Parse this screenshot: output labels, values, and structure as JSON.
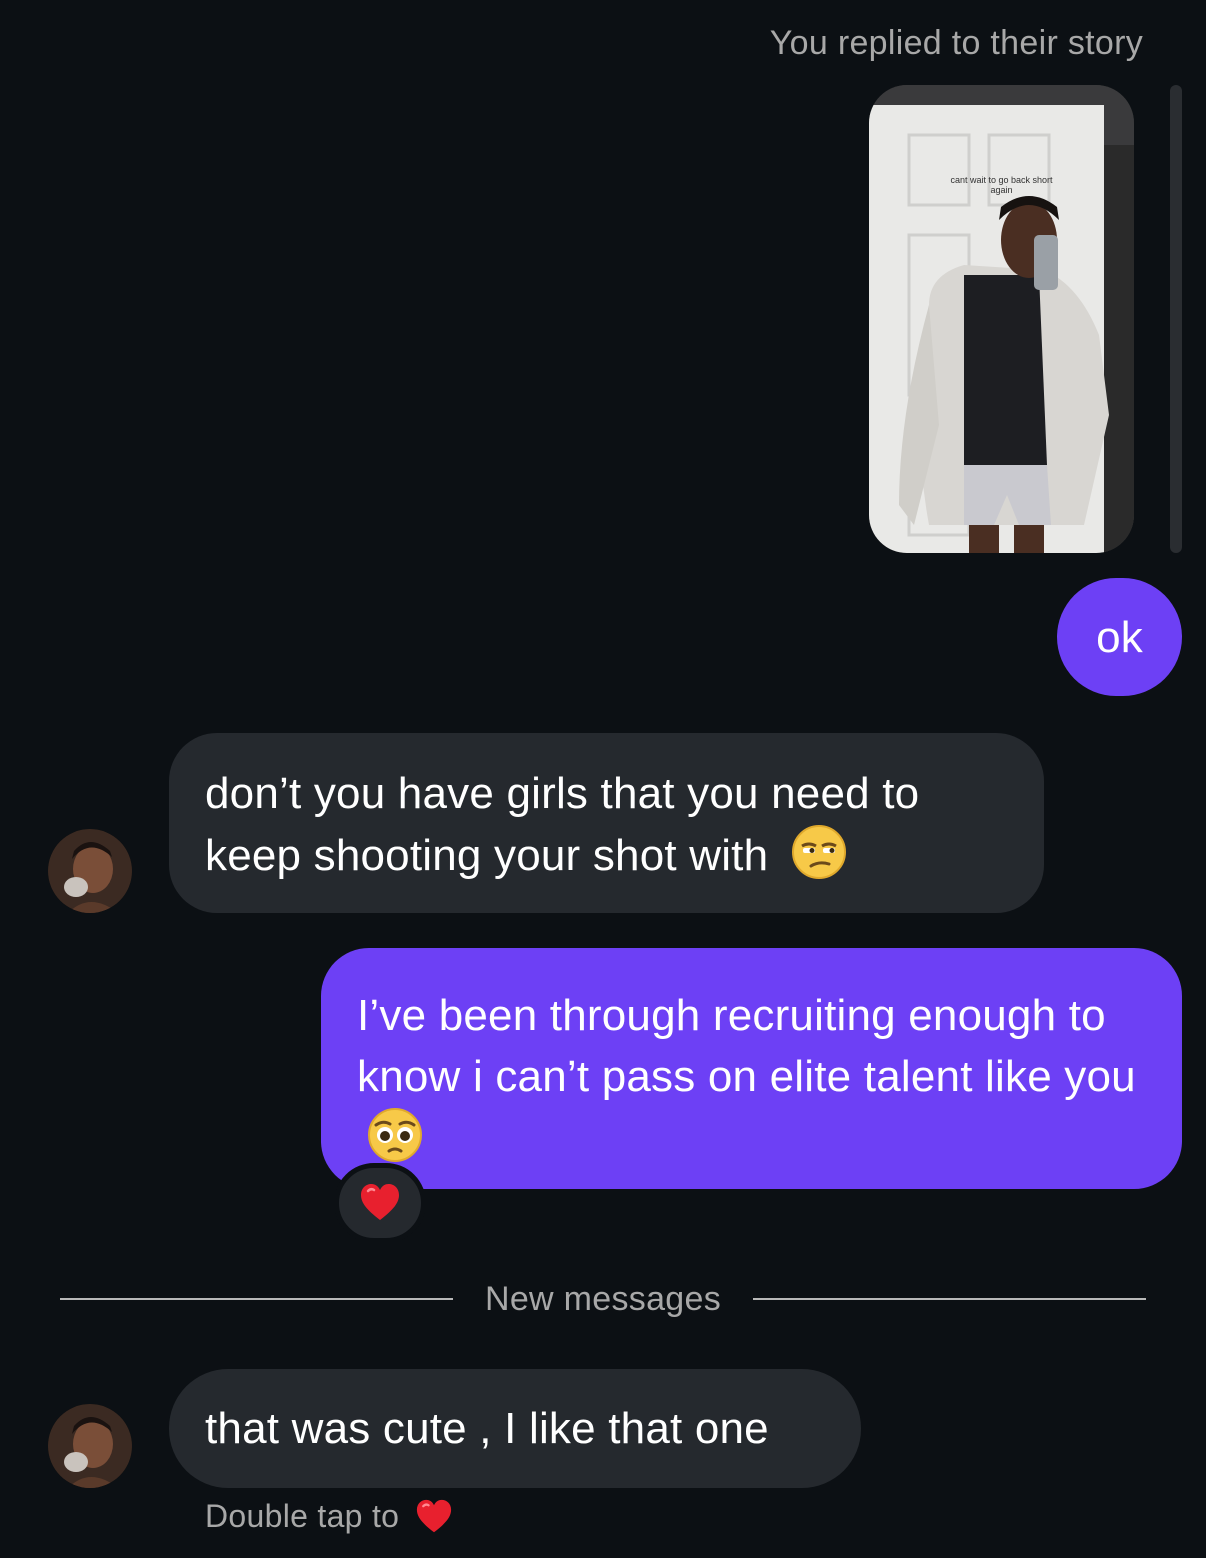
{
  "thread": {
    "story_reply_caption": "You replied to their story",
    "story": {
      "overlay_text_line1": "cant wait to go back short",
      "overlay_text_line2": "again"
    },
    "messages": [
      {
        "from": "me",
        "text": "ok"
      },
      {
        "from": "them",
        "text": "don’t you have girls that you need to keep shooting your shot with",
        "emoji": "unamused-face"
      },
      {
        "from": "me",
        "text": "I’ve been through recruiting enough to know i can’t pass on elite talent like you",
        "emoji": "pleading-face",
        "reaction": "red-heart"
      },
      {
        "from": "them",
        "text": "that was cute , I like that one"
      }
    ],
    "new_messages_label": "New messages",
    "double_tap_hint": "Double tap to",
    "double_tap_icon": "red-heart"
  },
  "colors": {
    "background": "#0c1014",
    "sent_bubble": "#6d40f5",
    "received_bubble": "#25292e",
    "secondary_text": "#a8a8a8",
    "heart": "#e8202e"
  }
}
